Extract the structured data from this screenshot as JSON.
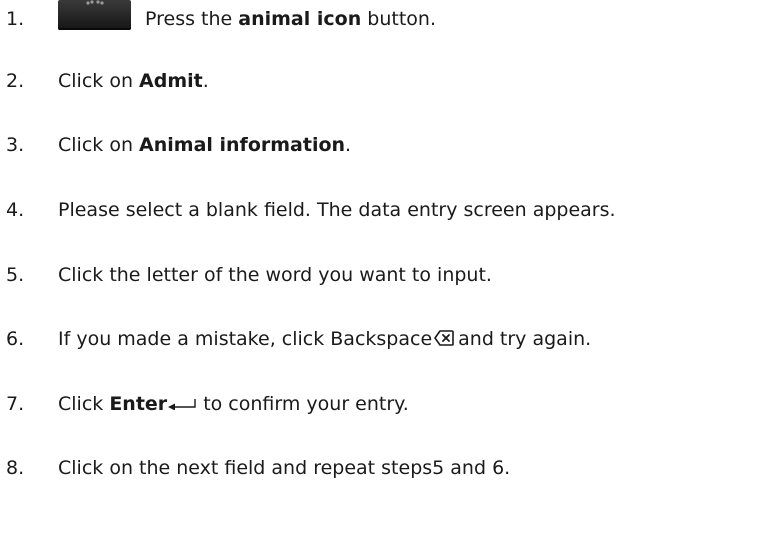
{
  "steps": [
    {
      "number": "1.",
      "pre": "Press the ",
      "bold": "animal icon",
      "post": " button.",
      "icon": "animal-icon-button"
    },
    {
      "number": "2.",
      "pre": "Click on ",
      "bold": "Admit",
      "post": "."
    },
    {
      "number": "3.",
      "pre": "Click on ",
      "bold": "Animal information",
      "post": "."
    },
    {
      "number": "4.",
      "text": "Please select a blank field. The data entry screen appears."
    },
    {
      "number": "5.",
      "text": "Click the letter of the word you want to input."
    },
    {
      "number": "6.",
      "pre": "If you made a mistake, click Backspace",
      "post": "and try again.",
      "icon": "backspace-icon"
    },
    {
      "number": "7.",
      "pre": "Click ",
      "bold": "Enter",
      "post": "to confirm your entry.",
      "icon": "enter-arrow-icon"
    },
    {
      "number": "8.",
      "text": "Click on the next field and repeat steps5 and 6."
    }
  ]
}
